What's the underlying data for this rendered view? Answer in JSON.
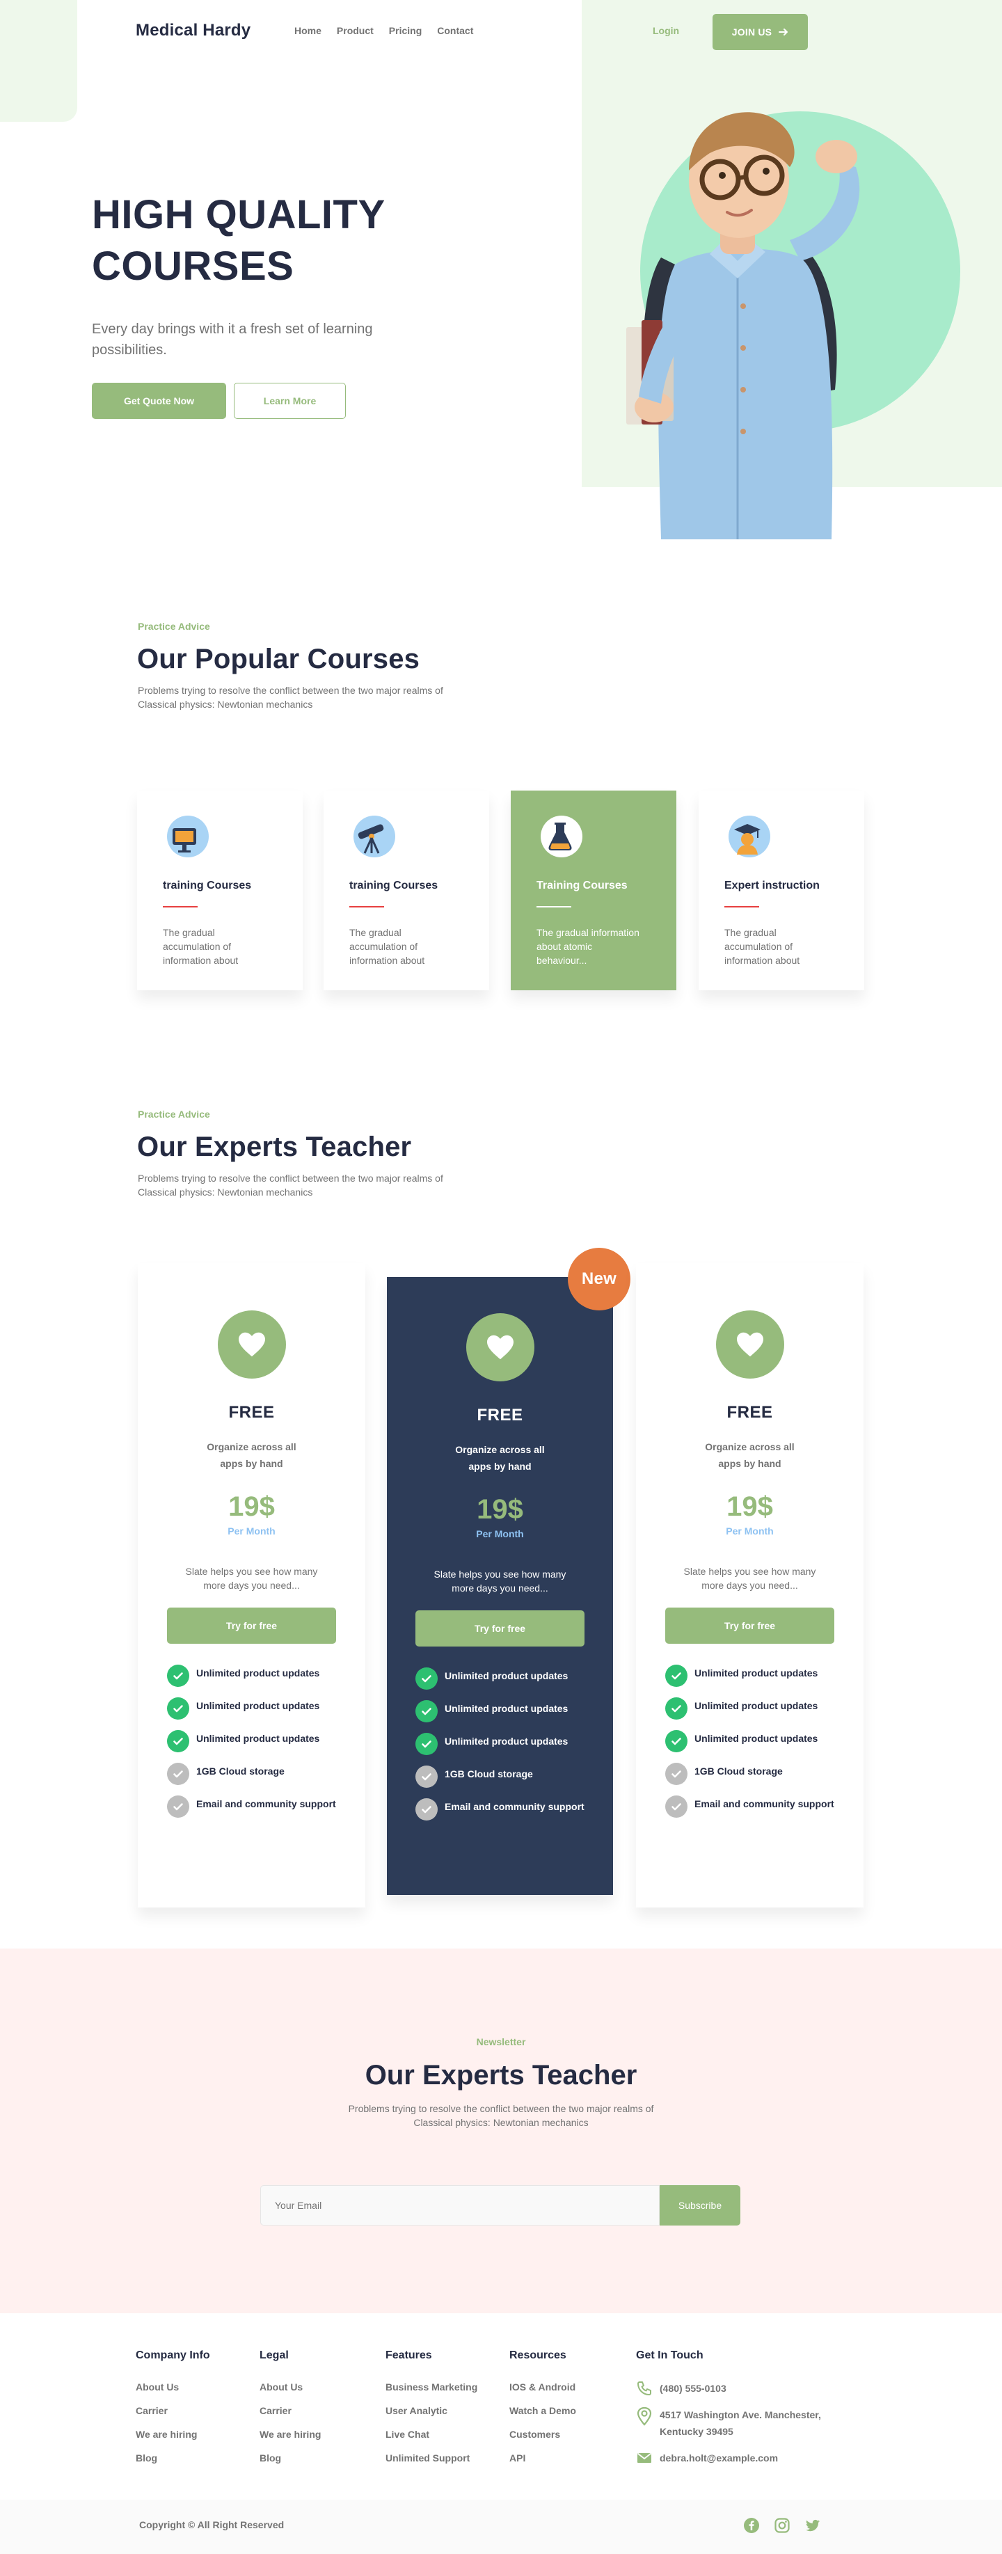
{
  "header": {
    "brand": "Medical Hardy",
    "nav": [
      "Home",
      "Product",
      "Pricing",
      "Contact"
    ],
    "login": "Login",
    "join": "JOIN US"
  },
  "hero": {
    "title": "HIGH QUALITY COURSES",
    "subtitle": "Every day brings with it a fresh set of learning possibilities.",
    "primary_cta": "Get Quote Now",
    "secondary_cta": "Learn More"
  },
  "courses": {
    "eyebrow": "Practice Advice",
    "title": "Our Popular Courses",
    "description": "Problems trying to resolve the conflict between the two major realms of Classical physics: Newtonian mechanics",
    "cards": [
      {
        "title": "training Courses",
        "desc": "The gradual accumulation of information about",
        "icon": "computer-icon"
      },
      {
        "title": "training Courses",
        "desc": "The gradual accumulation of information about",
        "icon": "telescope-icon"
      },
      {
        "title": "Training Courses",
        "desc": "The gradual information about atomic behaviour...",
        "icon": "flask-icon"
      },
      {
        "title": "Expert instruction",
        "desc": "The gradual accumulation of information about",
        "icon": "graduate-icon"
      }
    ]
  },
  "experts": {
    "eyebrow": "Practice Advice",
    "title": "Our Experts Teacher",
    "description": "Problems trying to resolve the conflict between the two major realms of Classical physics: Newtonian mechanics",
    "badge": "New",
    "plans": [
      {
        "name": "FREE",
        "sub": "Organize across all apps by hand",
        "price": "19$",
        "period": "Per Month",
        "desc": "Slate helps you see how many more days you need...",
        "cta": "Try for free",
        "features": [
          {
            "label": "Unlimited product updates",
            "included": true
          },
          {
            "label": "Unlimited product updates",
            "included": true
          },
          {
            "label": "Unlimited product updates",
            "included": true
          },
          {
            "label": "1GB  Cloud storage",
            "included": false
          },
          {
            "label": "Email and community support",
            "included": false
          }
        ]
      },
      {
        "name": "FREE",
        "sub": "Organize across all apps by hand",
        "price": "19$",
        "period": "Per Month",
        "desc": "Slate helps you see how many more days you need...",
        "cta": "Try for free",
        "features": [
          {
            "label": "Unlimited product updates",
            "included": true
          },
          {
            "label": "Unlimited product updates",
            "included": true
          },
          {
            "label": "Unlimited product updates",
            "included": true
          },
          {
            "label": "1GB  Cloud storage",
            "included": false
          },
          {
            "label": "Email and community support",
            "included": false
          }
        ]
      },
      {
        "name": "FREE",
        "sub": "Organize across all apps by hand",
        "price": "19$",
        "period": "Per Month",
        "desc": "Slate helps you see how many more days you need...",
        "cta": "Try for free",
        "features": [
          {
            "label": "Unlimited product updates",
            "included": true
          },
          {
            "label": "Unlimited product updates",
            "included": true
          },
          {
            "label": "Unlimited product updates",
            "included": true
          },
          {
            "label": "1GB  Cloud storage",
            "included": false
          },
          {
            "label": "Email and community support",
            "included": false
          }
        ]
      }
    ]
  },
  "newsletter": {
    "eyebrow": "Newsletter",
    "title": "Our Experts Teacher",
    "description": "Problems trying to resolve the conflict between the two major realms of Classical physics: Newtonian mechanics",
    "placeholder": "Your Email",
    "button": "Subscribe"
  },
  "footer": {
    "columns": [
      {
        "title": "Company Info",
        "links": [
          "About Us",
          "Carrier",
          "We are hiring",
          "Blog"
        ]
      },
      {
        "title": "Legal",
        "links": [
          "About Us",
          "Carrier",
          "We are hiring",
          "Blog"
        ]
      },
      {
        "title": "Features",
        "links": [
          "Business Marketing",
          "User Analytic",
          "Live Chat",
          "Unlimited Support"
        ]
      },
      {
        "title": "Resources",
        "links": [
          "IOS & Android",
          "Watch a Demo",
          "Customers",
          "API"
        ]
      }
    ],
    "contact": {
      "title": "Get In Touch",
      "phone": "(480) 555-0103",
      "address": "4517 Washington Ave. Manchester, Kentucky 39495",
      "email": "debra.holt@example.com"
    },
    "copyright": "Copyright © All Right Reserved",
    "socials": [
      "facebook-icon",
      "instagram-icon",
      "twitter-icon"
    ]
  },
  "colors": {
    "primary": "#96BB7C",
    "dark": "#252B42",
    "navy_card": "#2D3C58",
    "badge": "#E77C40",
    "check": "#2DC071",
    "newsletter_bg": "#FFF1F0"
  }
}
